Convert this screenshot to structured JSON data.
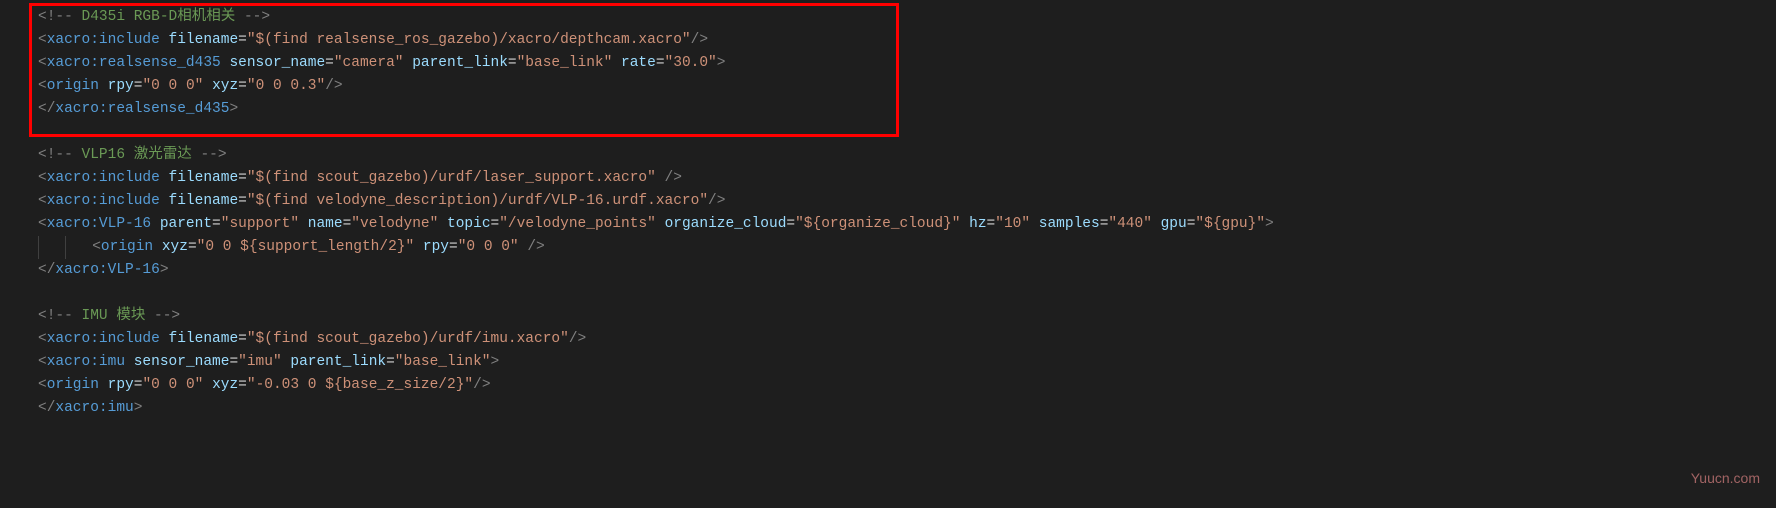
{
  "watermark": "Yuucn.com",
  "lines": [
    {
      "type": "comment",
      "indent": 0,
      "tokens": [
        {
          "t": "tag-bracket",
          "v": "<!--"
        },
        {
          "t": "comment",
          "v": " D435i RGB-D相机相关 "
        },
        {
          "t": "tag-bracket",
          "v": "-->"
        }
      ]
    },
    {
      "type": "tag",
      "indent": 0,
      "tokens": [
        {
          "t": "tag-bracket",
          "v": "<"
        },
        {
          "t": "tag-name",
          "v": "xacro:include"
        },
        {
          "t": "plain",
          "v": " "
        },
        {
          "t": "attr-name",
          "v": "filename"
        },
        {
          "t": "equals",
          "v": "="
        },
        {
          "t": "attr-value",
          "v": "\"$(find realsense_ros_gazebo)/xacro/depthcam.xacro\""
        },
        {
          "t": "tag-bracket",
          "v": "/>"
        }
      ]
    },
    {
      "type": "tag",
      "indent": 0,
      "tokens": [
        {
          "t": "tag-bracket",
          "v": "<"
        },
        {
          "t": "tag-name",
          "v": "xacro:realsense_d435"
        },
        {
          "t": "plain",
          "v": " "
        },
        {
          "t": "attr-name",
          "v": "sensor_name"
        },
        {
          "t": "equals",
          "v": "="
        },
        {
          "t": "attr-value",
          "v": "\"camera\""
        },
        {
          "t": "plain",
          "v": " "
        },
        {
          "t": "attr-name",
          "v": "parent_link"
        },
        {
          "t": "equals",
          "v": "="
        },
        {
          "t": "attr-value",
          "v": "\"base_link\""
        },
        {
          "t": "plain",
          "v": " "
        },
        {
          "t": "attr-name",
          "v": "rate"
        },
        {
          "t": "equals",
          "v": "="
        },
        {
          "t": "attr-value",
          "v": "\"30.0\""
        },
        {
          "t": "tag-bracket",
          "v": ">"
        }
      ]
    },
    {
      "type": "tag",
      "indent": 0,
      "tokens": [
        {
          "t": "tag-bracket",
          "v": "<"
        },
        {
          "t": "tag-name",
          "v": "origin"
        },
        {
          "t": "plain",
          "v": " "
        },
        {
          "t": "attr-name",
          "v": "rpy"
        },
        {
          "t": "equals",
          "v": "="
        },
        {
          "t": "attr-value",
          "v": "\"0 0 0\""
        },
        {
          "t": "plain",
          "v": " "
        },
        {
          "t": "attr-name",
          "v": "xyz"
        },
        {
          "t": "equals",
          "v": "="
        },
        {
          "t": "attr-value",
          "v": "\"0 0 0.3\""
        },
        {
          "t": "tag-bracket",
          "v": "/>"
        }
      ]
    },
    {
      "type": "tag",
      "indent": 0,
      "tokens": [
        {
          "t": "tag-bracket",
          "v": "</"
        },
        {
          "t": "tag-name",
          "v": "xacro:realsense_d435"
        },
        {
          "t": "tag-bracket",
          "v": ">"
        }
      ]
    },
    {
      "type": "blank"
    },
    {
      "type": "comment",
      "indent": 0,
      "tokens": [
        {
          "t": "tag-bracket",
          "v": "<!--"
        },
        {
          "t": "comment",
          "v": " VLP16 激光雷达 "
        },
        {
          "t": "tag-bracket",
          "v": "-->"
        }
      ]
    },
    {
      "type": "tag",
      "indent": 0,
      "tokens": [
        {
          "t": "tag-bracket",
          "v": "<"
        },
        {
          "t": "tag-name",
          "v": "xacro:include"
        },
        {
          "t": "plain",
          "v": " "
        },
        {
          "t": "attr-name",
          "v": "filename"
        },
        {
          "t": "equals",
          "v": "="
        },
        {
          "t": "attr-value",
          "v": "\"$(find scout_gazebo)/urdf/laser_support.xacro\""
        },
        {
          "t": "plain",
          "v": " "
        },
        {
          "t": "tag-bracket",
          "v": "/>"
        }
      ]
    },
    {
      "type": "tag",
      "indent": 0,
      "tokens": [
        {
          "t": "tag-bracket",
          "v": "<"
        },
        {
          "t": "tag-name",
          "v": "xacro:include"
        },
        {
          "t": "plain",
          "v": " "
        },
        {
          "t": "attr-name",
          "v": "filename"
        },
        {
          "t": "equals",
          "v": "="
        },
        {
          "t": "attr-value",
          "v": "\"$(find velodyne_description)/urdf/VLP-16.urdf.xacro\""
        },
        {
          "t": "tag-bracket",
          "v": "/>"
        }
      ]
    },
    {
      "type": "tag",
      "indent": 0,
      "tokens": [
        {
          "t": "tag-bracket",
          "v": "<"
        },
        {
          "t": "tag-name",
          "v": "xacro:VLP-16"
        },
        {
          "t": "plain",
          "v": " "
        },
        {
          "t": "attr-name",
          "v": "parent"
        },
        {
          "t": "equals",
          "v": "="
        },
        {
          "t": "attr-value",
          "v": "\"support\""
        },
        {
          "t": "plain",
          "v": " "
        },
        {
          "t": "attr-name",
          "v": "name"
        },
        {
          "t": "equals",
          "v": "="
        },
        {
          "t": "attr-value",
          "v": "\"velodyne\""
        },
        {
          "t": "plain",
          "v": " "
        },
        {
          "t": "attr-name",
          "v": "topic"
        },
        {
          "t": "equals",
          "v": "="
        },
        {
          "t": "attr-value",
          "v": "\"/velodyne_points\""
        },
        {
          "t": "plain",
          "v": " "
        },
        {
          "t": "attr-name",
          "v": "organize_cloud"
        },
        {
          "t": "equals",
          "v": "="
        },
        {
          "t": "attr-value",
          "v": "\"${organize_cloud}\""
        },
        {
          "t": "plain",
          "v": " "
        },
        {
          "t": "attr-name",
          "v": "hz"
        },
        {
          "t": "equals",
          "v": "="
        },
        {
          "t": "attr-value",
          "v": "\"10\""
        },
        {
          "t": "plain",
          "v": " "
        },
        {
          "t": "attr-name",
          "v": "samples"
        },
        {
          "t": "equals",
          "v": "="
        },
        {
          "t": "attr-value",
          "v": "\"440\""
        },
        {
          "t": "plain",
          "v": " "
        },
        {
          "t": "attr-name",
          "v": "gpu"
        },
        {
          "t": "equals",
          "v": "="
        },
        {
          "t": "attr-value",
          "v": "\"${gpu}\""
        },
        {
          "t": "tag-bracket",
          "v": ">"
        }
      ]
    },
    {
      "type": "tag",
      "indent": 2,
      "tokens": [
        {
          "t": "tag-bracket",
          "v": "<"
        },
        {
          "t": "tag-name",
          "v": "origin"
        },
        {
          "t": "plain",
          "v": " "
        },
        {
          "t": "attr-name",
          "v": "xyz"
        },
        {
          "t": "equals",
          "v": "="
        },
        {
          "t": "attr-value",
          "v": "\"0 0 ${support_length/2}\""
        },
        {
          "t": "plain",
          "v": " "
        },
        {
          "t": "attr-name",
          "v": "rpy"
        },
        {
          "t": "equals",
          "v": "="
        },
        {
          "t": "attr-value",
          "v": "\"0 0 0\""
        },
        {
          "t": "plain",
          "v": " "
        },
        {
          "t": "tag-bracket",
          "v": "/>"
        }
      ]
    },
    {
      "type": "tag",
      "indent": 0,
      "tokens": [
        {
          "t": "tag-bracket",
          "v": "</"
        },
        {
          "t": "tag-name",
          "v": "xacro:VLP-16"
        },
        {
          "t": "tag-bracket",
          "v": ">"
        }
      ]
    },
    {
      "type": "blank"
    },
    {
      "type": "comment",
      "indent": 0,
      "tokens": [
        {
          "t": "tag-bracket",
          "v": "<!--"
        },
        {
          "t": "comment",
          "v": " IMU 模块 "
        },
        {
          "t": "tag-bracket",
          "v": "-->"
        }
      ]
    },
    {
      "type": "tag",
      "indent": 0,
      "tokens": [
        {
          "t": "tag-bracket",
          "v": "<"
        },
        {
          "t": "tag-name",
          "v": "xacro:include"
        },
        {
          "t": "plain",
          "v": " "
        },
        {
          "t": "attr-name",
          "v": "filename"
        },
        {
          "t": "equals",
          "v": "="
        },
        {
          "t": "attr-value",
          "v": "\"$(find scout_gazebo)/urdf/imu.xacro\""
        },
        {
          "t": "tag-bracket",
          "v": "/>"
        }
      ]
    },
    {
      "type": "tag",
      "indent": 0,
      "tokens": [
        {
          "t": "tag-bracket",
          "v": "<"
        },
        {
          "t": "tag-name",
          "v": "xacro:imu"
        },
        {
          "t": "plain",
          "v": " "
        },
        {
          "t": "attr-name",
          "v": "sensor_name"
        },
        {
          "t": "equals",
          "v": "="
        },
        {
          "t": "attr-value",
          "v": "\"imu\""
        },
        {
          "t": "plain",
          "v": " "
        },
        {
          "t": "attr-name",
          "v": "parent_link"
        },
        {
          "t": "equals",
          "v": "="
        },
        {
          "t": "attr-value",
          "v": "\"base_link\""
        },
        {
          "t": "tag-bracket",
          "v": ">"
        }
      ]
    },
    {
      "type": "tag",
      "indent": 0,
      "tokens": [
        {
          "t": "tag-bracket",
          "v": "<"
        },
        {
          "t": "tag-name",
          "v": "origin"
        },
        {
          "t": "plain",
          "v": " "
        },
        {
          "t": "attr-name",
          "v": "rpy"
        },
        {
          "t": "equals",
          "v": "="
        },
        {
          "t": "attr-value",
          "v": "\"0 0 0\""
        },
        {
          "t": "plain",
          "v": " "
        },
        {
          "t": "attr-name",
          "v": "xyz"
        },
        {
          "t": "equals",
          "v": "="
        },
        {
          "t": "attr-value",
          "v": "\"-0.03 0 ${base_z_size/2}\""
        },
        {
          "t": "tag-bracket",
          "v": "/>"
        }
      ]
    },
    {
      "type": "tag",
      "indent": 0,
      "tokens": [
        {
          "t": "tag-bracket",
          "v": "</"
        },
        {
          "t": "tag-name",
          "v": "xacro:imu"
        },
        {
          "t": "tag-bracket",
          "v": ">"
        }
      ]
    }
  ]
}
